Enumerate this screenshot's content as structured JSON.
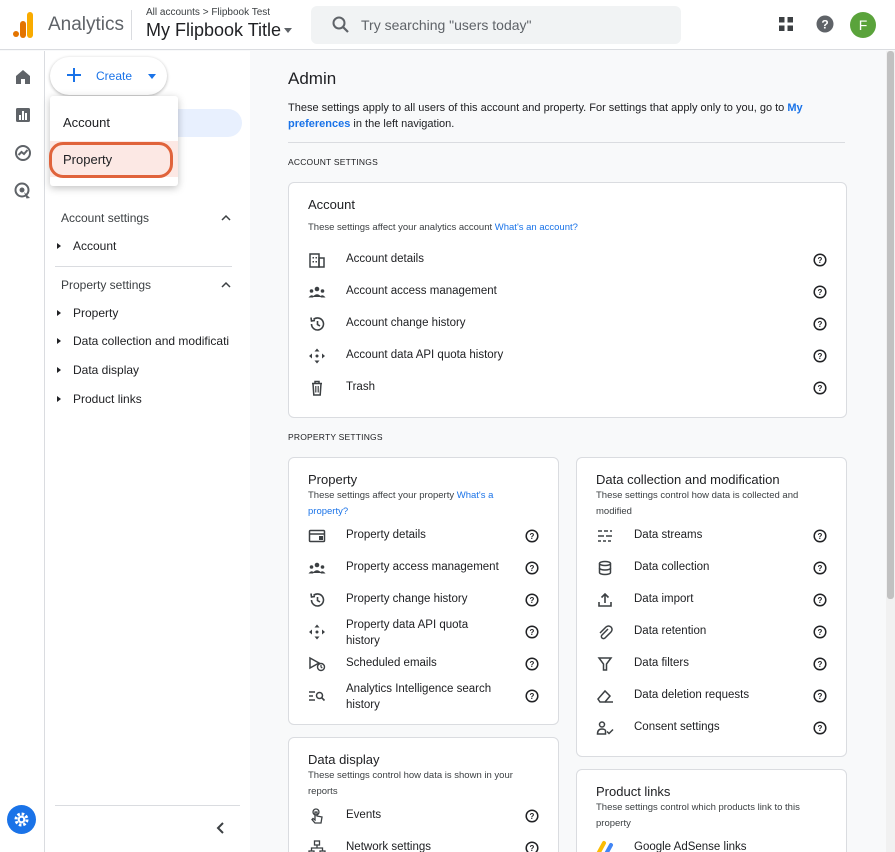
{
  "topbar": {
    "app_name": "Analytics",
    "breadcrumb": "All accounts > Flipbook Test",
    "property_title": "My Flipbook Title",
    "search_placeholder": "Try searching \"users today\"",
    "avatar_letter": "F",
    "icons": [
      "analytics-logo-icon",
      "search-icon",
      "apps-grid-icon",
      "help-icon"
    ]
  },
  "create": {
    "label": "Create"
  },
  "dropdown": {
    "items": [
      {
        "label": "Account"
      },
      {
        "label": "Property",
        "highlighted": true
      }
    ]
  },
  "sidenav": {
    "account_settings": {
      "title": "Account settings",
      "items": [
        "Account"
      ]
    },
    "property_settings": {
      "title": "Property settings",
      "items": [
        "Property",
        "Data collection and modificati",
        "Data display",
        "Product links"
      ]
    }
  },
  "main": {
    "title": "Admin",
    "desc_prefix": "These settings apply to all users of this account and property. For settings that apply only to you, go to ",
    "desc_link": "My preferences",
    "desc_suffix": " in the left navigation.",
    "account_settings_title": "ACCOUNT SETTINGS",
    "property_settings_title": "PROPERTY SETTINGS",
    "account_card": {
      "title": "Account",
      "desc": "These settings affect your analytics account",
      "desc_link": "What's an account?",
      "rows": [
        {
          "label": "Account details",
          "icon": "building-icon"
        },
        {
          "label": "Account access management",
          "icon": "people-icon"
        },
        {
          "label": "Account change history",
          "icon": "history-icon"
        },
        {
          "label": "Account data API quota history",
          "icon": "api-arrows-icon"
        },
        {
          "label": "Trash",
          "icon": "trash-icon"
        }
      ]
    },
    "property_card": {
      "title": "Property",
      "desc": "These settings affect your property",
      "desc_link": "What's a property?",
      "rows": [
        {
          "label": "Property details",
          "icon": "card-icon"
        },
        {
          "label": "Property access management",
          "icon": "people-icon"
        },
        {
          "label": "Property change history",
          "icon": "history-icon"
        },
        {
          "label": "Property data API quota history",
          "icon": "api-arrows-icon"
        },
        {
          "label": "Scheduled emails",
          "icon": "scheduled-email-icon"
        },
        {
          "label": "Analytics Intelligence search history",
          "icon": "search-list-icon"
        }
      ]
    },
    "data_collection_card": {
      "title": "Data collection and modification",
      "desc": "These settings control how data is collected and modified",
      "rows": [
        {
          "label": "Data streams",
          "icon": "streams-icon"
        },
        {
          "label": "Data collection",
          "icon": "database-icon"
        },
        {
          "label": "Data import",
          "icon": "upload-icon"
        },
        {
          "label": "Data retention",
          "icon": "paperclip-icon"
        },
        {
          "label": "Data filters",
          "icon": "filter-icon"
        },
        {
          "label": "Data deletion requests",
          "icon": "eraser-icon"
        },
        {
          "label": "Consent settings",
          "icon": "consent-icon"
        }
      ]
    },
    "data_display_card": {
      "title": "Data display",
      "desc": "These settings control how data is shown in your reports",
      "rows": [
        {
          "label": "Events",
          "icon": "touch-icon"
        },
        {
          "label": "Network settings",
          "icon": "network-icon"
        }
      ]
    },
    "product_links_card": {
      "title": "Product links",
      "desc": "These settings control which products link to this property",
      "rows": [
        {
          "label": "Google AdSense links",
          "icon": "adsense-icon"
        }
      ]
    }
  },
  "colors": {
    "accent": "#1a73e8",
    "highlight_ring": "#e0633b",
    "avatar": "#5aa33b"
  }
}
